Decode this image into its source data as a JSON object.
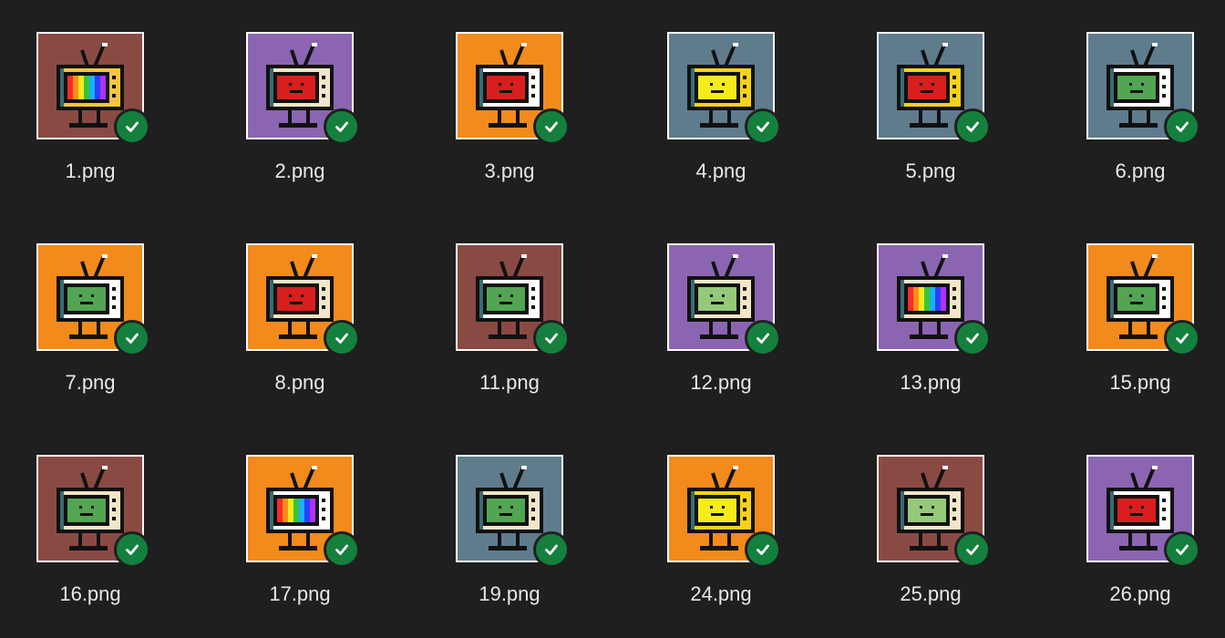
{
  "files": [
    {
      "name": "1.png",
      "bg": "#8a4a44",
      "body": "#f4c542",
      "screen": "rainbow",
      "status": "selected"
    },
    {
      "name": "2.png",
      "bg": "#8b65b1",
      "body": "#f3e5c8",
      "screen": "#d81e1e",
      "status": "selected"
    },
    {
      "name": "3.png",
      "bg": "#f28a1c",
      "body": "#ffffff",
      "screen": "#d81e1e",
      "status": "selected"
    },
    {
      "name": "4.png",
      "bg": "#5f7c8d",
      "body": "#f7d21b",
      "screen": "#f5ec1a",
      "status": "selected"
    },
    {
      "name": "5.png",
      "bg": "#5f7c8d",
      "body": "#f7d21b",
      "screen": "#d81e1e",
      "status": "selected"
    },
    {
      "name": "6.png",
      "bg": "#5f7c8d",
      "body": "#ffffff",
      "screen": "#52a552",
      "status": "selected"
    },
    {
      "name": "7.png",
      "bg": "#f28a1c",
      "body": "#ffffff",
      "screen": "#52a552",
      "status": "selected"
    },
    {
      "name": "8.png",
      "bg": "#f28a1c",
      "body": "#f3e5c8",
      "screen": "#d81e1e",
      "status": "selected"
    },
    {
      "name": "11.png",
      "bg": "#8a4a44",
      "body": "#ffffff",
      "screen": "#52a552",
      "status": "selected"
    },
    {
      "name": "12.png",
      "bg": "#8b65b1",
      "body": "#f3e5c8",
      "screen": "#94c97a",
      "status": "selected"
    },
    {
      "name": "13.png",
      "bg": "#8b65b1",
      "body": "#f3e5c8",
      "screen": "rainbow",
      "status": "selected"
    },
    {
      "name": "15.png",
      "bg": "#f28a1c",
      "body": "#ffffff",
      "screen": "#52a552",
      "status": "selected"
    },
    {
      "name": "16.png",
      "bg": "#8a4a44",
      "body": "#f3e5c8",
      "screen": "#52a552",
      "status": "selected"
    },
    {
      "name": "17.png",
      "bg": "#f28a1c",
      "body": "#ffffff",
      "screen": "rainbow",
      "status": "selected"
    },
    {
      "name": "19.png",
      "bg": "#5f7c8d",
      "body": "#f3e5c8",
      "screen": "#52a552",
      "status": "selected"
    },
    {
      "name": "24.png",
      "bg": "#f28a1c",
      "body": "#f7d21b",
      "screen": "#f5ec1a",
      "status": "selected"
    },
    {
      "name": "25.png",
      "bg": "#8a4a44",
      "body": "#f3e5c8",
      "screen": "#94c97a",
      "status": "selected"
    },
    {
      "name": "26.png",
      "bg": "#8b65b1",
      "body": "#ffffff",
      "screen": "#d81e1e",
      "status": "selected"
    }
  ],
  "icons": {
    "selected": "checkmark-badge-icon"
  },
  "colors": {
    "background": "#1f1f1f",
    "check": "#15803d",
    "label": "#e8e8e8"
  }
}
